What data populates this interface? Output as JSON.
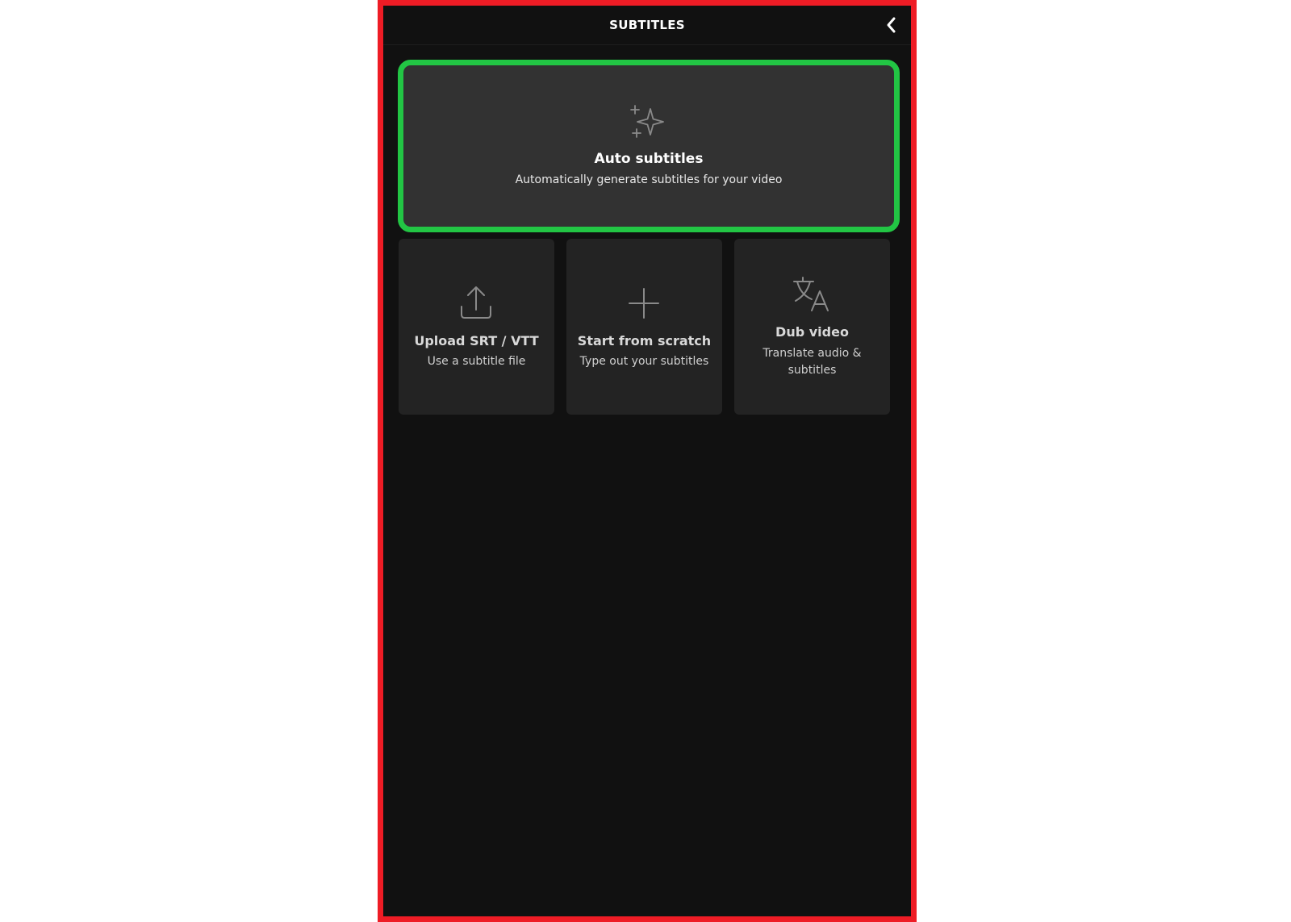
{
  "header": {
    "title": "SUBTITLES",
    "back_icon": "chevron-left-icon"
  },
  "auto_subtitles": {
    "title": "Auto subtitles",
    "description": "Automatically generate subtitles for your video",
    "icon": "sparkles-icon"
  },
  "options": [
    {
      "title": "Upload SRT / VTT",
      "description": "Use a subtitle file",
      "icon": "upload-icon"
    },
    {
      "title": "Start from scratch",
      "description": "Type out your subtitles",
      "icon": "plus-icon"
    },
    {
      "title": "Dub video",
      "description": "Translate audio & subtitles",
      "icon": "translate-icon"
    }
  ],
  "colors": {
    "frame_border": "#ee1c25",
    "highlight_border": "#22c544",
    "panel_background": "#111111",
    "card_background": "#232323"
  }
}
